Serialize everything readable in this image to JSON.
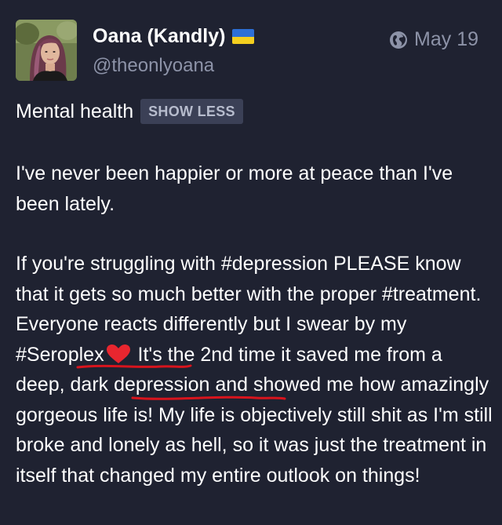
{
  "author": {
    "display_name": "Oana (Kandly)",
    "handle": "@theonlyoana"
  },
  "timestamp": "May 19",
  "content_warning": {
    "text": "Mental health",
    "toggle_label": "SHOW LESS"
  },
  "body": {
    "p1": "I've never been happier or more at peace than I've been lately.",
    "p2_a": "If you're struggling with ",
    "tag_depression": "#depression",
    "p2_b": " PLEASE know that it gets so much better with the proper ",
    "tag_treatment": "#treatment",
    "p2_c": ". Everyone reacts differently but I swear by my ",
    "tag_seroplex": "#Seroplex",
    "p2_d": " It's the 2nd time it saved me from a ",
    "underlined_phrase": "deep, dark depression",
    "p2_e": " and showed me how amazingly gorgeous life is! My life is objectively still shit as I'm still broke and lonely as hell, so it was just the treatment in itself that changed my entire outlook on things!"
  },
  "colors": {
    "background": "#1f2231",
    "secondary_text": "#8d93a8",
    "heart": "#e8262f",
    "annotation_underline": "#d8141d",
    "flag_blue": "#2d6fd6",
    "flag_yellow": "#f4cf1f"
  },
  "icons": {
    "visibility": "globe-icon",
    "emoji": "red-heart-icon",
    "flag": "ukraine-flag-icon"
  }
}
